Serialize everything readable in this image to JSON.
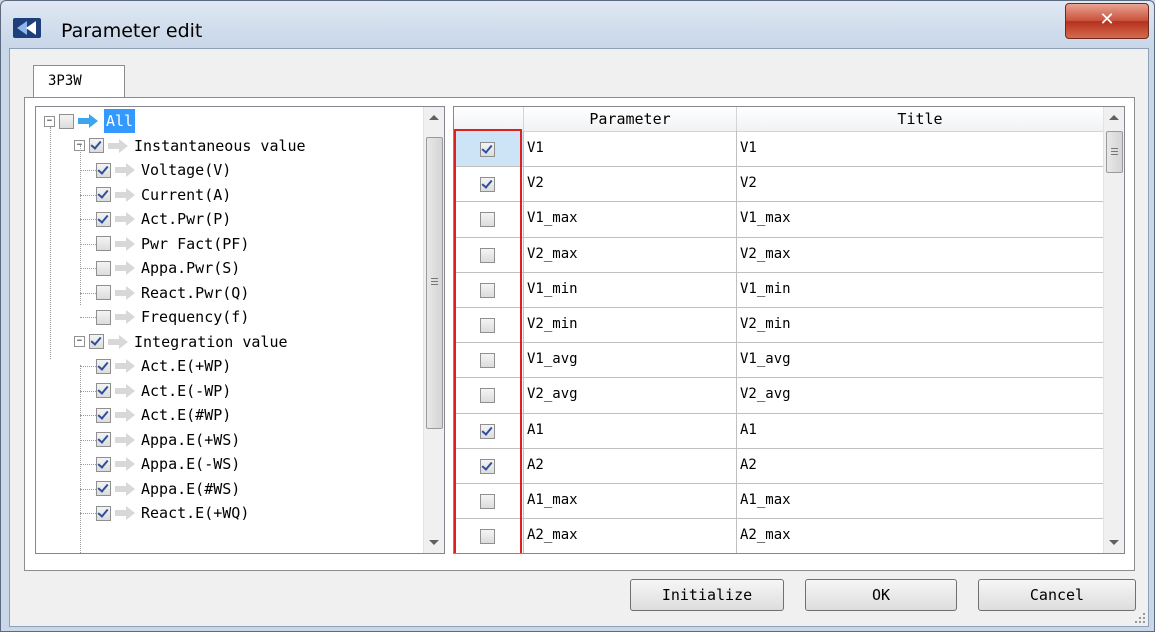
{
  "window": {
    "title": "Parameter edit",
    "close_glyph": "✕"
  },
  "tabs": [
    {
      "label": "3P3W",
      "selected": true
    }
  ],
  "tree": {
    "nodes": [
      {
        "label": "All",
        "level": 0,
        "checked": false,
        "expander": "−",
        "arrow": "blue",
        "selected": true
      },
      {
        "label": "Instantaneous value",
        "level": 1,
        "checked": true,
        "expander": "−"
      },
      {
        "label": "Voltage(V)",
        "level": 2,
        "checked": true
      },
      {
        "label": "Current(A)",
        "level": 2,
        "checked": true
      },
      {
        "label": "Act.Pwr(P)",
        "level": 2,
        "checked": true
      },
      {
        "label": "Pwr Fact(PF)",
        "level": 2,
        "checked": false
      },
      {
        "label": "Appa.Pwr(S)",
        "level": 2,
        "checked": false
      },
      {
        "label": "React.Pwr(Q)",
        "level": 2,
        "checked": false
      },
      {
        "label": "Frequency(f)",
        "level": 2,
        "checked": false
      },
      {
        "label": "Integration value",
        "level": 1,
        "checked": true,
        "expander": "−"
      },
      {
        "label": "Act.E(+WP)",
        "level": 2,
        "checked": true
      },
      {
        "label": "Act.E(-WP)",
        "level": 2,
        "checked": true
      },
      {
        "label": "Act.E(#WP)",
        "level": 2,
        "checked": true
      },
      {
        "label": "Appa.E(+WS)",
        "level": 2,
        "checked": true
      },
      {
        "label": "Appa.E(-WS)",
        "level": 2,
        "checked": true
      },
      {
        "label": "Appa.E(#WS)",
        "level": 2,
        "checked": true
      },
      {
        "label": "React.E(+WQ)",
        "level": 2,
        "checked": true
      }
    ]
  },
  "grid": {
    "columns": [
      "",
      "Parameter",
      "Title"
    ],
    "rows": [
      {
        "checked": true,
        "parameter": "V1",
        "title": "V1"
      },
      {
        "checked": true,
        "parameter": "V2",
        "title": "V2"
      },
      {
        "checked": false,
        "parameter": "V1_max",
        "title": "V1_max"
      },
      {
        "checked": false,
        "parameter": "V2_max",
        "title": "V2_max"
      },
      {
        "checked": false,
        "parameter": "V1_min",
        "title": "V1_min"
      },
      {
        "checked": false,
        "parameter": "V2_min",
        "title": "V2_min"
      },
      {
        "checked": false,
        "parameter": "V1_avg",
        "title": "V1_avg"
      },
      {
        "checked": false,
        "parameter": "V2_avg",
        "title": "V2_avg"
      },
      {
        "checked": true,
        "parameter": "A1",
        "title": "A1"
      },
      {
        "checked": true,
        "parameter": "A2",
        "title": "A2"
      },
      {
        "checked": false,
        "parameter": "A1_max",
        "title": "A1_max"
      },
      {
        "checked": false,
        "parameter": "A2_max",
        "title": "A2_max"
      }
    ]
  },
  "buttons": {
    "initialize": "Initialize",
    "ok": "OK",
    "cancel": "Cancel"
  },
  "colors": {
    "highlight": "#e0201e",
    "selection": "#3399ff",
    "check": "#2c4f9e"
  }
}
